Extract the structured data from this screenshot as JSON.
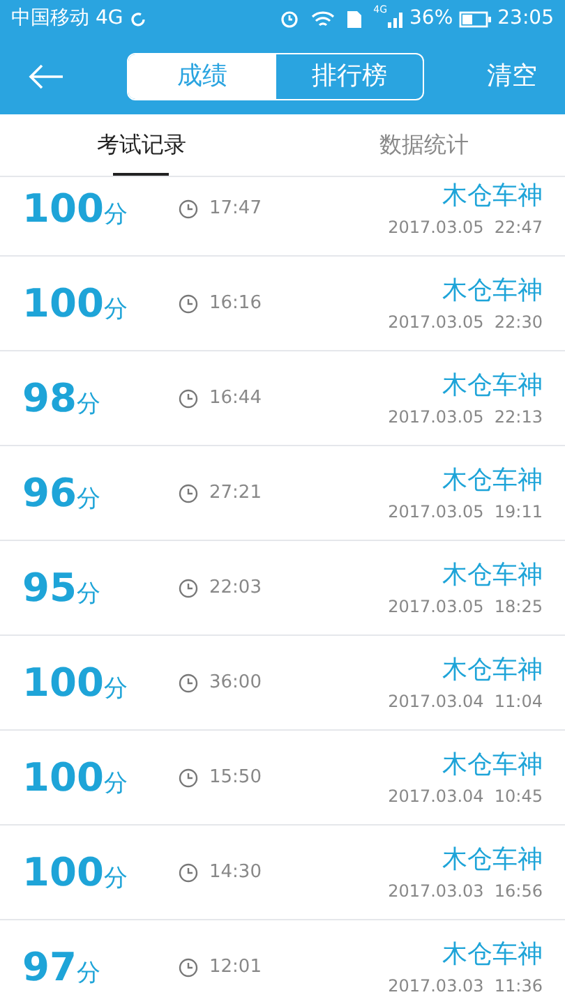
{
  "status_bar": {
    "carrier": "中国移动 4G",
    "network_badge": "4G",
    "battery": "36%",
    "time": "23:05"
  },
  "header": {
    "segments": [
      {
        "label": "成绩",
        "selected": true
      },
      {
        "label": "排行榜",
        "selected": false
      }
    ],
    "action": "清空"
  },
  "tabs": [
    {
      "label": "考试记录",
      "selected": true
    },
    {
      "label": "数据统计",
      "selected": false
    }
  ],
  "records": [
    {
      "score": "100",
      "unit": "分",
      "duration": "17:47",
      "name": "木仓车神",
      "date": "2017.03.05  22:47"
    },
    {
      "score": "100",
      "unit": "分",
      "duration": "16:16",
      "name": "木仓车神",
      "date": "2017.03.05  22:30"
    },
    {
      "score": "98",
      "unit": "分",
      "duration": "16:44",
      "name": "木仓车神",
      "date": "2017.03.05  22:13"
    },
    {
      "score": "96",
      "unit": "分",
      "duration": "27:21",
      "name": "木仓车神",
      "date": "2017.03.05  19:11"
    },
    {
      "score": "95",
      "unit": "分",
      "duration": "22:03",
      "name": "木仓车神",
      "date": "2017.03.05  18:25"
    },
    {
      "score": "100",
      "unit": "分",
      "duration": "36:00",
      "name": "木仓车神",
      "date": "2017.03.04  11:04"
    },
    {
      "score": "100",
      "unit": "分",
      "duration": "15:50",
      "name": "木仓车神",
      "date": "2017.03.04  10:45"
    },
    {
      "score": "100",
      "unit": "分",
      "duration": "14:30",
      "name": "木仓车神",
      "date": "2017.03.03  16:56"
    },
    {
      "score": "97",
      "unit": "分",
      "duration": "12:01",
      "name": "木仓车神",
      "date": "2017.03.03  11:36"
    }
  ]
}
